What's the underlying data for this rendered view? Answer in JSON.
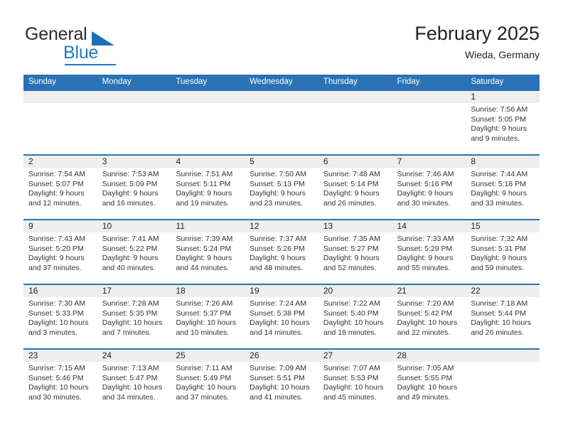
{
  "brand": {
    "name_part1": "General",
    "name_part2": "Blue",
    "triangle_icon": "triangle-icon",
    "accent_color": "#1f7ac4"
  },
  "header": {
    "title": "February 2025",
    "location": "Wieda, Germany"
  },
  "theme": {
    "header_blue": "#2a72b5",
    "band_gray": "#eeeeee",
    "text": "#231f20"
  },
  "weekdays": [
    "Sunday",
    "Monday",
    "Tuesday",
    "Wednesday",
    "Thursday",
    "Friday",
    "Saturday"
  ],
  "weeks": [
    [
      {
        "day": "",
        "sunrise": "",
        "sunset": "",
        "daylight_line1": "",
        "daylight_line2": "",
        "empty": true
      },
      {
        "day": "",
        "sunrise": "",
        "sunset": "",
        "daylight_line1": "",
        "daylight_line2": "",
        "empty": true
      },
      {
        "day": "",
        "sunrise": "",
        "sunset": "",
        "daylight_line1": "",
        "daylight_line2": "",
        "empty": true
      },
      {
        "day": "",
        "sunrise": "",
        "sunset": "",
        "daylight_line1": "",
        "daylight_line2": "",
        "empty": true
      },
      {
        "day": "",
        "sunrise": "",
        "sunset": "",
        "daylight_line1": "",
        "daylight_line2": "",
        "empty": true
      },
      {
        "day": "",
        "sunrise": "",
        "sunset": "",
        "daylight_line1": "",
        "daylight_line2": "",
        "empty": true
      },
      {
        "day": "1",
        "sunrise": "Sunrise: 7:56 AM",
        "sunset": "Sunset: 5:05 PM",
        "daylight_line1": "Daylight: 9 hours",
        "daylight_line2": "and 9 minutes."
      }
    ],
    [
      {
        "day": "2",
        "sunrise": "Sunrise: 7:54 AM",
        "sunset": "Sunset: 5:07 PM",
        "daylight_line1": "Daylight: 9 hours",
        "daylight_line2": "and 12 minutes."
      },
      {
        "day": "3",
        "sunrise": "Sunrise: 7:53 AM",
        "sunset": "Sunset: 5:09 PM",
        "daylight_line1": "Daylight: 9 hours",
        "daylight_line2": "and 16 minutes."
      },
      {
        "day": "4",
        "sunrise": "Sunrise: 7:51 AM",
        "sunset": "Sunset: 5:11 PM",
        "daylight_line1": "Daylight: 9 hours",
        "daylight_line2": "and 19 minutes."
      },
      {
        "day": "5",
        "sunrise": "Sunrise: 7:50 AM",
        "sunset": "Sunset: 5:13 PM",
        "daylight_line1": "Daylight: 9 hours",
        "daylight_line2": "and 23 minutes."
      },
      {
        "day": "6",
        "sunrise": "Sunrise: 7:48 AM",
        "sunset": "Sunset: 5:14 PM",
        "daylight_line1": "Daylight: 9 hours",
        "daylight_line2": "and 26 minutes."
      },
      {
        "day": "7",
        "sunrise": "Sunrise: 7:46 AM",
        "sunset": "Sunset: 5:16 PM",
        "daylight_line1": "Daylight: 9 hours",
        "daylight_line2": "and 30 minutes."
      },
      {
        "day": "8",
        "sunrise": "Sunrise: 7:44 AM",
        "sunset": "Sunset: 5:18 PM",
        "daylight_line1": "Daylight: 9 hours",
        "daylight_line2": "and 33 minutes."
      }
    ],
    [
      {
        "day": "9",
        "sunrise": "Sunrise: 7:43 AM",
        "sunset": "Sunset: 5:20 PM",
        "daylight_line1": "Daylight: 9 hours",
        "daylight_line2": "and 37 minutes."
      },
      {
        "day": "10",
        "sunrise": "Sunrise: 7:41 AM",
        "sunset": "Sunset: 5:22 PM",
        "daylight_line1": "Daylight: 9 hours",
        "daylight_line2": "and 40 minutes."
      },
      {
        "day": "11",
        "sunrise": "Sunrise: 7:39 AM",
        "sunset": "Sunset: 5:24 PM",
        "daylight_line1": "Daylight: 9 hours",
        "daylight_line2": "and 44 minutes."
      },
      {
        "day": "12",
        "sunrise": "Sunrise: 7:37 AM",
        "sunset": "Sunset: 5:26 PM",
        "daylight_line1": "Daylight: 9 hours",
        "daylight_line2": "and 48 minutes."
      },
      {
        "day": "13",
        "sunrise": "Sunrise: 7:35 AM",
        "sunset": "Sunset: 5:27 PM",
        "daylight_line1": "Daylight: 9 hours",
        "daylight_line2": "and 52 minutes."
      },
      {
        "day": "14",
        "sunrise": "Sunrise: 7:33 AM",
        "sunset": "Sunset: 5:29 PM",
        "daylight_line1": "Daylight: 9 hours",
        "daylight_line2": "and 55 minutes."
      },
      {
        "day": "15",
        "sunrise": "Sunrise: 7:32 AM",
        "sunset": "Sunset: 5:31 PM",
        "daylight_line1": "Daylight: 9 hours",
        "daylight_line2": "and 59 minutes."
      }
    ],
    [
      {
        "day": "16",
        "sunrise": "Sunrise: 7:30 AM",
        "sunset": "Sunset: 5:33 PM",
        "daylight_line1": "Daylight: 10 hours",
        "daylight_line2": "and 3 minutes."
      },
      {
        "day": "17",
        "sunrise": "Sunrise: 7:28 AM",
        "sunset": "Sunset: 5:35 PM",
        "daylight_line1": "Daylight: 10 hours",
        "daylight_line2": "and 7 minutes."
      },
      {
        "day": "18",
        "sunrise": "Sunrise: 7:26 AM",
        "sunset": "Sunset: 5:37 PM",
        "daylight_line1": "Daylight: 10 hours",
        "daylight_line2": "and 10 minutes."
      },
      {
        "day": "19",
        "sunrise": "Sunrise: 7:24 AM",
        "sunset": "Sunset: 5:38 PM",
        "daylight_line1": "Daylight: 10 hours",
        "daylight_line2": "and 14 minutes."
      },
      {
        "day": "20",
        "sunrise": "Sunrise: 7:22 AM",
        "sunset": "Sunset: 5:40 PM",
        "daylight_line1": "Daylight: 10 hours",
        "daylight_line2": "and 18 minutes."
      },
      {
        "day": "21",
        "sunrise": "Sunrise: 7:20 AM",
        "sunset": "Sunset: 5:42 PM",
        "daylight_line1": "Daylight: 10 hours",
        "daylight_line2": "and 22 minutes."
      },
      {
        "day": "22",
        "sunrise": "Sunrise: 7:18 AM",
        "sunset": "Sunset: 5:44 PM",
        "daylight_line1": "Daylight: 10 hours",
        "daylight_line2": "and 26 minutes."
      }
    ],
    [
      {
        "day": "23",
        "sunrise": "Sunrise: 7:15 AM",
        "sunset": "Sunset: 5:46 PM",
        "daylight_line1": "Daylight: 10 hours",
        "daylight_line2": "and 30 minutes."
      },
      {
        "day": "24",
        "sunrise": "Sunrise: 7:13 AM",
        "sunset": "Sunset: 5:47 PM",
        "daylight_line1": "Daylight: 10 hours",
        "daylight_line2": "and 34 minutes."
      },
      {
        "day": "25",
        "sunrise": "Sunrise: 7:11 AM",
        "sunset": "Sunset: 5:49 PM",
        "daylight_line1": "Daylight: 10 hours",
        "daylight_line2": "and 37 minutes."
      },
      {
        "day": "26",
        "sunrise": "Sunrise: 7:09 AM",
        "sunset": "Sunset: 5:51 PM",
        "daylight_line1": "Daylight: 10 hours",
        "daylight_line2": "and 41 minutes."
      },
      {
        "day": "27",
        "sunrise": "Sunrise: 7:07 AM",
        "sunset": "Sunset: 5:53 PM",
        "daylight_line1": "Daylight: 10 hours",
        "daylight_line2": "and 45 minutes."
      },
      {
        "day": "28",
        "sunrise": "Sunrise: 7:05 AM",
        "sunset": "Sunset: 5:55 PM",
        "daylight_line1": "Daylight: 10 hours",
        "daylight_line2": "and 49 minutes."
      },
      {
        "day": "",
        "sunrise": "",
        "sunset": "",
        "daylight_line1": "",
        "daylight_line2": "",
        "empty": true
      }
    ]
  ]
}
